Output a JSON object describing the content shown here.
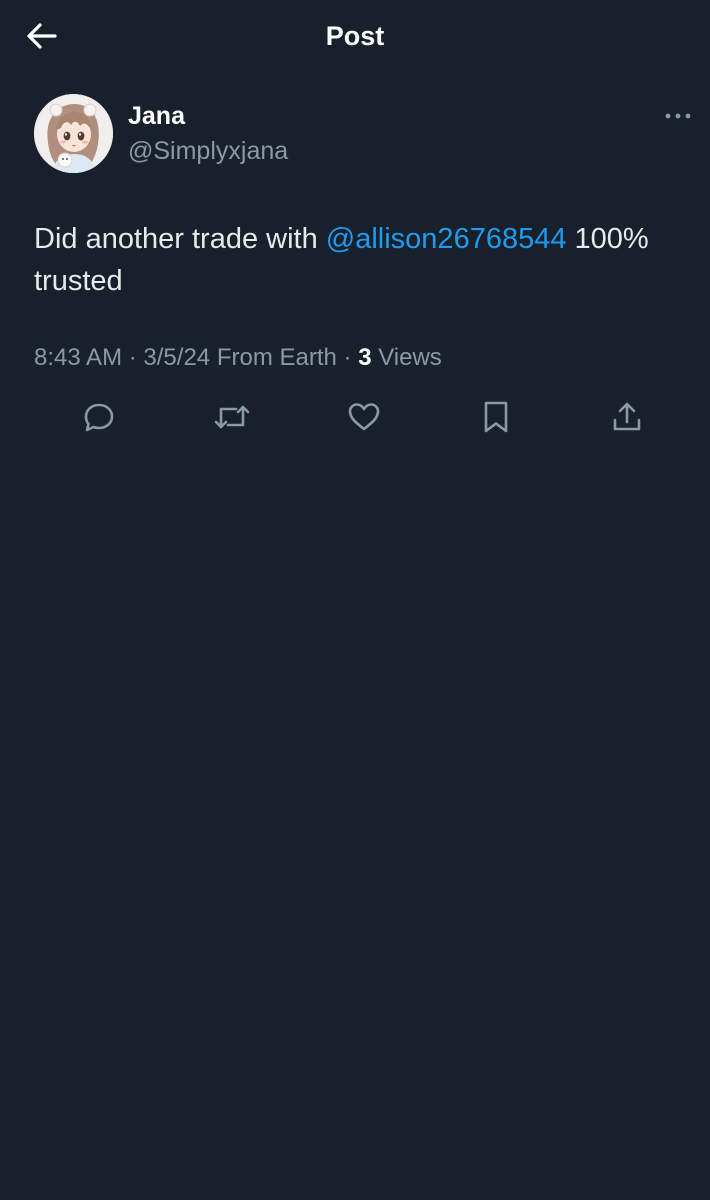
{
  "header": {
    "title": "Post",
    "back_icon": "arrow-left-icon"
  },
  "post": {
    "author": {
      "display_name": "Jana",
      "handle": "@Simplyxjana",
      "avatar": "anime-girl-avatar"
    },
    "more_icon": "more-horizontal-icon",
    "text_before": "Did another trade with ",
    "mention": "@allison26768544",
    "text_after": " 100% trusted",
    "time": "8:43 AM",
    "date": "3/5/24",
    "source": "From Earth",
    "separator": "·",
    "views_count": "3",
    "views_label": "Views"
  },
  "actions": [
    {
      "name": "reply",
      "icon": "reply-icon"
    },
    {
      "name": "repost",
      "icon": "repost-icon"
    },
    {
      "name": "like",
      "icon": "heart-icon"
    },
    {
      "name": "bookmark",
      "icon": "bookmark-icon"
    },
    {
      "name": "share",
      "icon": "share-icon"
    }
  ],
  "colors": {
    "background": "#18202b",
    "text": "#e7e9ea",
    "secondary_text": "#8b98a5",
    "accent": "#1d9bf0"
  }
}
